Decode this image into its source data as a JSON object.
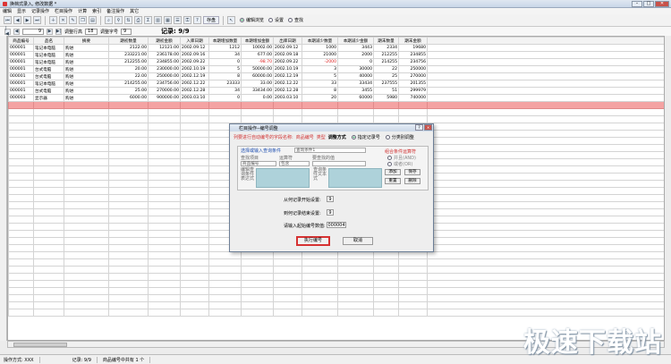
{
  "window": {
    "title": "换档式录入, 修改数据 *"
  },
  "menu": [
    "编辑",
    "显示",
    "记录操作",
    "栏目操作",
    "计算",
    "索引",
    "备注操作",
    "其它"
  ],
  "toolbar": {
    "save_label": "存盘",
    "radio1": "编辑浏览",
    "radio2": "设置",
    "radio3": "查找"
  },
  "nav": {
    "current": "9",
    "adjust_label": "调整行高",
    "adjust_value": "18",
    "adjust_char_label": "调整字号",
    "adjust_char_value": "9",
    "record_label": "记录: 9/9"
  },
  "table": {
    "columns": [
      "商品编号",
      "品名",
      "摘要",
      "期初数量",
      "期初金额",
      "入库日期",
      "本期增加数量",
      "本期增加金额",
      "出库日期",
      "本期减少数量",
      "本期减少金额",
      "期末数量",
      "期末金额"
    ],
    "rows": [
      [
        "000001",
        "笔记本电脑",
        "购进",
        "2122.00",
        "12121.00",
        "2002.09.12",
        "1212",
        "10002.00",
        "2002.09.12",
        "1000",
        "3443",
        "2334",
        "19680"
      ],
      [
        "000001",
        "笔记本电脑",
        "购进",
        "233221.00",
        "236178.00",
        "2002.09.16",
        "34",
        "677.00",
        "2002.09.18",
        "21000",
        "2000",
        "212255",
        "234855"
      ],
      [
        "000001",
        "笔记本电脑",
        "购进",
        "212255.00",
        "234855.00",
        "2002.09.22",
        "0",
        "-98.70",
        "2002.09.22",
        "-2000",
        "0",
        "214255",
        "234756"
      ],
      [
        "000001",
        "台式电脑",
        "购进",
        "20.00",
        "230000.00",
        "2002.10.19",
        "5",
        "50000.00",
        "2002.10.19",
        "3",
        "30000",
        "22",
        "250000"
      ],
      [
        "000001",
        "台式电脑",
        "购进",
        "22.00",
        "250000.00",
        "2002.12.19",
        "8",
        "60000.00",
        "2002.12.19",
        "5",
        "40000",
        "25",
        "270000"
      ],
      [
        "000001",
        "笔记本电脑",
        "购进",
        "214255.00",
        "234756.00",
        "2002.12.22",
        "23333",
        "33.00",
        "2002.12.22",
        "33",
        "33434",
        "237555",
        "201355"
      ],
      [
        "000001",
        "台式电脑",
        "购进",
        "25.00",
        "270000.00",
        "2002.12.28",
        "34",
        "33434.00",
        "2002.12.28",
        "8",
        "3455",
        "51",
        "299979"
      ],
      [
        "000003",
        "显示器",
        "购进",
        "6000.00",
        "900000.00",
        "2003.03.10",
        "0",
        "0.00",
        "2003.03.10",
        "20",
        "60000",
        "5980",
        "740000"
      ]
    ]
  },
  "dialog": {
    "title": "栏目操作--编号调整",
    "intro": "列要进行自动编号的字段名称:",
    "field_name": "商品编号",
    "type_label": "类型",
    "mode_label": "调整方式",
    "opt1": "指定记录号",
    "opt2": "分类别调整",
    "group_title": "选择或输入查询条件",
    "field_placeholder": "查询条件1",
    "find_item": "查找项目",
    "operator": "运算符",
    "value_label": "要查找的值",
    "item_select": "商品编号",
    "op_select": "包含",
    "edit_label": "编辑查询条件表达式",
    "query_label": "查询条件文本式",
    "cond_group": "组合条件运算符",
    "and_label": "并且(AND)",
    "or_label": "或者(OR)",
    "add": "添加",
    "save": "保存",
    "reset": "重置",
    "delete": "删除",
    "start_label": "从何记录开始设置:",
    "start_value": "9",
    "end_label": "到何记录结束设置:",
    "end_value": "9",
    "init_label": "请输入起始编号数值:",
    "init_value": "000004",
    "exec": "执行编号",
    "cancel": "取消"
  },
  "status": {
    "mode": "操作方式: XXX",
    "record": "记录: 9/9",
    "info": "商品编号中共有 1 个"
  },
  "watermark": "极速下载站"
}
